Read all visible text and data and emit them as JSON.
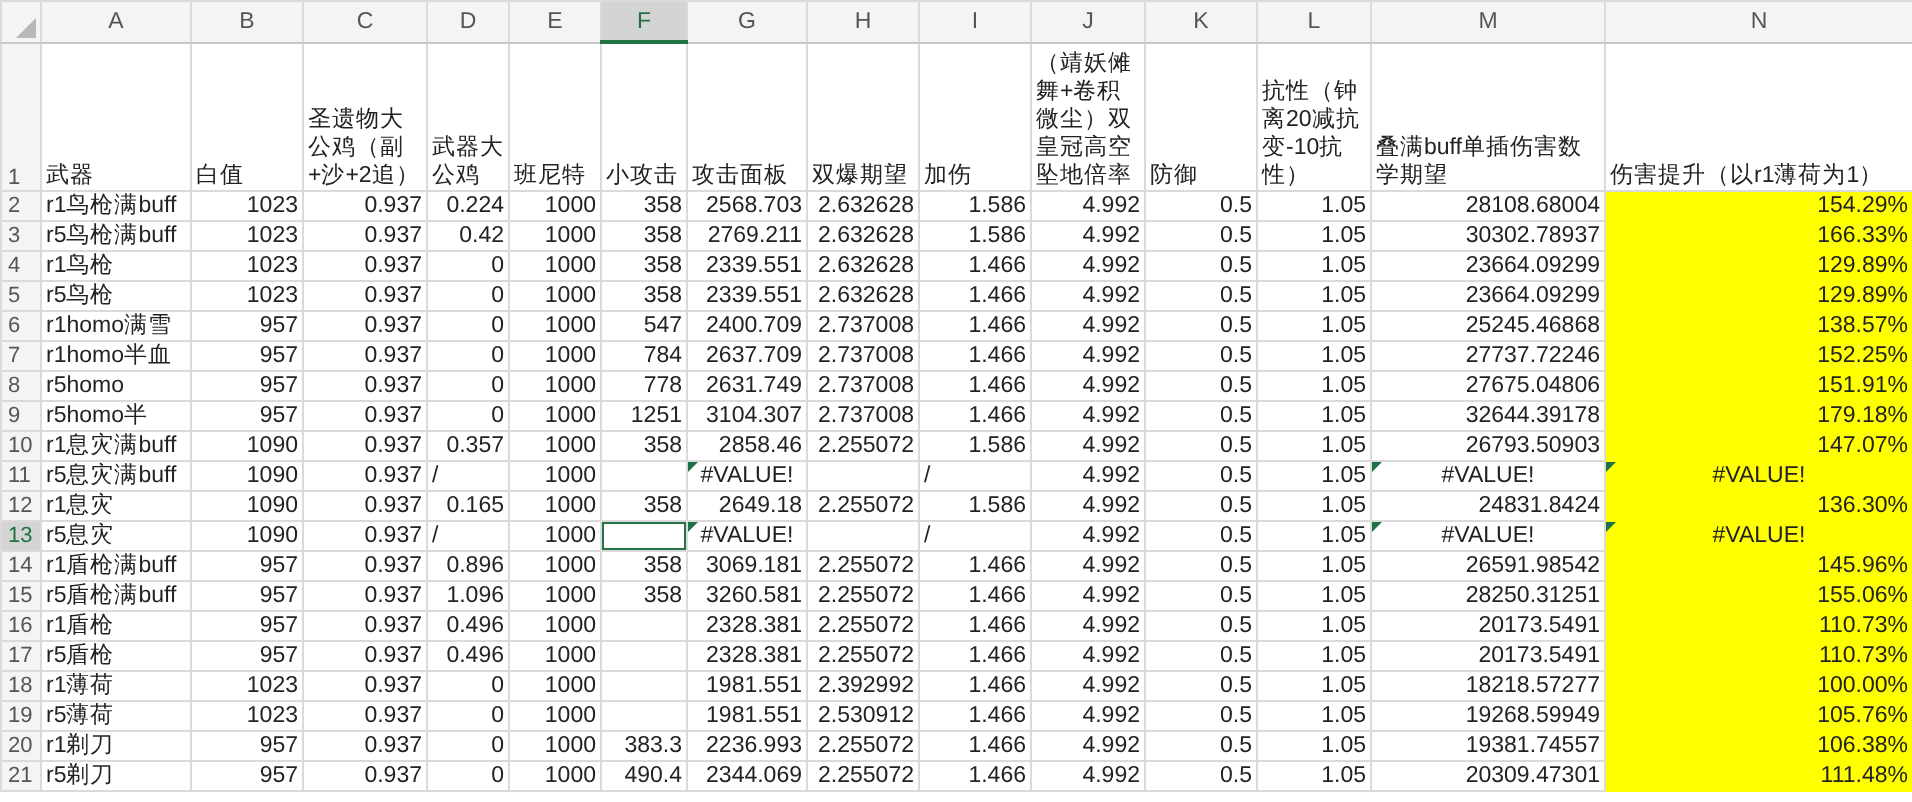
{
  "columns": [
    {
      "letter": "A",
      "selected": false,
      "highlighted": false
    },
    {
      "letter": "B",
      "selected": false,
      "highlighted": false
    },
    {
      "letter": "C",
      "selected": false,
      "highlighted": false
    },
    {
      "letter": "D",
      "selected": false,
      "highlighted": false
    },
    {
      "letter": "E",
      "selected": false,
      "highlighted": false
    },
    {
      "letter": "F",
      "selected": true,
      "highlighted": false
    },
    {
      "letter": "G",
      "selected": false,
      "highlighted": false
    },
    {
      "letter": "H",
      "selected": false,
      "highlighted": false
    },
    {
      "letter": "I",
      "selected": false,
      "highlighted": false
    },
    {
      "letter": "J",
      "selected": false,
      "highlighted": false
    },
    {
      "letter": "K",
      "selected": false,
      "highlighted": false
    },
    {
      "letter": "L",
      "selected": false,
      "highlighted": false
    },
    {
      "letter": "M",
      "selected": false,
      "highlighted": false
    },
    {
      "letter": "N",
      "selected": false,
      "highlighted": true
    }
  ],
  "header_row": {
    "number": "1",
    "cells": [
      "武器",
      "白值",
      "圣遗物大公鸡（副+沙+2追）",
      "武器大公鸡",
      "班尼特",
      "小攻击",
      "攻击面板",
      "双爆期望",
      "加伤",
      "（靖妖傩舞+卷积微尘）双皇冠高空坠地倍率",
      "防御",
      "抗性（钟离20减抗变-10抗性）",
      "叠满buff单插伤害数学期望",
      "伤害提升（以r1薄荷为1）"
    ]
  },
  "rows": [
    {
      "number": "2",
      "selected": false,
      "cells": [
        "r1鸟枪满buff",
        "1023",
        "0.937",
        "0.224",
        "1000",
        "358",
        "2568.703",
        "2.632628",
        "1.586",
        "4.992",
        "0.5",
        "1.05",
        "28108.68004",
        "154.29%"
      ],
      "error_marks": [
        false,
        false,
        false,
        false,
        false,
        false,
        false,
        false,
        false,
        false,
        false,
        false,
        false,
        false
      ]
    },
    {
      "number": "3",
      "selected": false,
      "cells": [
        "r5鸟枪满buff",
        "1023",
        "0.937",
        "0.42",
        "1000",
        "358",
        "2769.211",
        "2.632628",
        "1.586",
        "4.992",
        "0.5",
        "1.05",
        "30302.78937",
        "166.33%"
      ],
      "error_marks": [
        false,
        false,
        false,
        false,
        false,
        false,
        false,
        false,
        false,
        false,
        false,
        false,
        false,
        false
      ]
    },
    {
      "number": "4",
      "selected": false,
      "cells": [
        "r1鸟枪",
        "1023",
        "0.937",
        "0",
        "1000",
        "358",
        "2339.551",
        "2.632628",
        "1.466",
        "4.992",
        "0.5",
        "1.05",
        "23664.09299",
        "129.89%"
      ],
      "error_marks": [
        false,
        false,
        false,
        false,
        false,
        false,
        false,
        false,
        false,
        false,
        false,
        false,
        false,
        false
      ]
    },
    {
      "number": "5",
      "selected": false,
      "cells": [
        "r5鸟枪",
        "1023",
        "0.937",
        "0",
        "1000",
        "358",
        "2339.551",
        "2.632628",
        "1.466",
        "4.992",
        "0.5",
        "1.05",
        "23664.09299",
        "129.89%"
      ],
      "error_marks": [
        false,
        false,
        false,
        false,
        false,
        false,
        false,
        false,
        false,
        false,
        false,
        false,
        false,
        false
      ]
    },
    {
      "number": "6",
      "selected": false,
      "cells": [
        "r1homo满雪",
        "957",
        "0.937",
        "0",
        "1000",
        "547",
        "2400.709",
        "2.737008",
        "1.466",
        "4.992",
        "0.5",
        "1.05",
        "25245.46868",
        "138.57%"
      ],
      "error_marks": [
        false,
        false,
        false,
        false,
        false,
        false,
        false,
        false,
        false,
        false,
        false,
        false,
        false,
        false
      ]
    },
    {
      "number": "7",
      "selected": false,
      "cells": [
        "r1homo半血",
        "957",
        "0.937",
        "0",
        "1000",
        "784",
        "2637.709",
        "2.737008",
        "1.466",
        "4.992",
        "0.5",
        "1.05",
        "27737.72246",
        "152.25%"
      ],
      "error_marks": [
        false,
        false,
        false,
        false,
        false,
        false,
        false,
        false,
        false,
        false,
        false,
        false,
        false,
        false
      ]
    },
    {
      "number": "8",
      "selected": false,
      "cells": [
        "r5homo",
        "957",
        "0.937",
        "0",
        "1000",
        "778",
        "2631.749",
        "2.737008",
        "1.466",
        "4.992",
        "0.5",
        "1.05",
        "27675.04806",
        "151.91%"
      ],
      "error_marks": [
        false,
        false,
        false,
        false,
        false,
        false,
        false,
        false,
        false,
        false,
        false,
        false,
        false,
        false
      ]
    },
    {
      "number": "9",
      "selected": false,
      "cells": [
        "r5homo半",
        "957",
        "0.937",
        "0",
        "1000",
        "1251",
        "3104.307",
        "2.737008",
        "1.466",
        "4.992",
        "0.5",
        "1.05",
        "32644.39178",
        "179.18%"
      ],
      "error_marks": [
        false,
        false,
        false,
        false,
        false,
        false,
        false,
        false,
        false,
        false,
        false,
        false,
        false,
        false
      ]
    },
    {
      "number": "10",
      "selected": false,
      "cells": [
        "r1息灾满buff",
        "1090",
        "0.937",
        "0.357",
        "1000",
        "358",
        "2858.46",
        "2.255072",
        "1.586",
        "4.992",
        "0.5",
        "1.05",
        "26793.50903",
        "147.07%"
      ],
      "error_marks": [
        false,
        false,
        false,
        false,
        false,
        false,
        false,
        false,
        false,
        false,
        false,
        false,
        false,
        false
      ]
    },
    {
      "number": "11",
      "selected": false,
      "cells": [
        "r5息灾满buff",
        "1090",
        "0.937",
        "/",
        "1000",
        null,
        "#VALUE!",
        null,
        "/",
        "4.992",
        "0.5",
        "1.05",
        "#VALUE!",
        "#VALUE!"
      ],
      "error_marks": [
        false,
        false,
        false,
        false,
        false,
        false,
        true,
        false,
        false,
        false,
        false,
        false,
        true,
        true
      ]
    },
    {
      "number": "12",
      "selected": false,
      "cells": [
        "r1息灾",
        "1090",
        "0.937",
        "0.165",
        "1000",
        "358",
        "2649.18",
        "2.255072",
        "1.586",
        "4.992",
        "0.5",
        "1.05",
        "24831.8424",
        "136.30%"
      ],
      "error_marks": [
        false,
        false,
        false,
        false,
        false,
        false,
        false,
        false,
        false,
        false,
        false,
        false,
        false,
        false
      ]
    },
    {
      "number": "13",
      "selected": true,
      "cells": [
        "r5息灾",
        "1090",
        "0.937",
        "/",
        "1000",
        null,
        "#VALUE!",
        null,
        "/",
        "4.992",
        "0.5",
        "1.05",
        "#VALUE!",
        "#VALUE!"
      ],
      "error_marks": [
        false,
        false,
        false,
        false,
        false,
        false,
        true,
        false,
        false,
        false,
        false,
        false,
        true,
        true
      ]
    },
    {
      "number": "14",
      "selected": false,
      "cells": [
        "r1盾枪满buff",
        "957",
        "0.937",
        "0.896",
        "1000",
        "358",
        "3069.181",
        "2.255072",
        "1.466",
        "4.992",
        "0.5",
        "1.05",
        "26591.98542",
        "145.96%"
      ],
      "error_marks": [
        false,
        false,
        false,
        false,
        false,
        false,
        false,
        false,
        false,
        false,
        false,
        false,
        false,
        false
      ]
    },
    {
      "number": "15",
      "selected": false,
      "cells": [
        "r5盾枪满buff",
        "957",
        "0.937",
        "1.096",
        "1000",
        "358",
        "3260.581",
        "2.255072",
        "1.466",
        "4.992",
        "0.5",
        "1.05",
        "28250.31251",
        "155.06%"
      ],
      "error_marks": [
        false,
        false,
        false,
        false,
        false,
        false,
        false,
        false,
        false,
        false,
        false,
        false,
        false,
        false
      ]
    },
    {
      "number": "16",
      "selected": false,
      "cells": [
        "r1盾枪",
        "957",
        "0.937",
        "0.496",
        "1000",
        null,
        "2328.381",
        "2.255072",
        "1.466",
        "4.992",
        "0.5",
        "1.05",
        "20173.5491",
        "110.73%"
      ],
      "error_marks": [
        false,
        false,
        false,
        false,
        false,
        false,
        false,
        false,
        false,
        false,
        false,
        false,
        false,
        false
      ]
    },
    {
      "number": "17",
      "selected": false,
      "cells": [
        "r5盾枪",
        "957",
        "0.937",
        "0.496",
        "1000",
        null,
        "2328.381",
        "2.255072",
        "1.466",
        "4.992",
        "0.5",
        "1.05",
        "20173.5491",
        "110.73%"
      ],
      "error_marks": [
        false,
        false,
        false,
        false,
        false,
        false,
        false,
        false,
        false,
        false,
        false,
        false,
        false,
        false
      ]
    },
    {
      "number": "18",
      "selected": false,
      "cells": [
        "r1薄荷",
        "1023",
        "0.937",
        "0",
        "1000",
        null,
        "1981.551",
        "2.392992",
        "1.466",
        "4.992",
        "0.5",
        "1.05",
        "18218.57277",
        "100.00%"
      ],
      "error_marks": [
        false,
        false,
        false,
        false,
        false,
        false,
        false,
        false,
        false,
        false,
        false,
        false,
        false,
        false
      ]
    },
    {
      "number": "19",
      "selected": false,
      "cells": [
        "r5薄荷",
        "1023",
        "0.937",
        "0",
        "1000",
        null,
        "1981.551",
        "2.530912",
        "1.466",
        "4.992",
        "0.5",
        "1.05",
        "19268.59949",
        "105.76%"
      ],
      "error_marks": [
        false,
        false,
        false,
        false,
        false,
        false,
        false,
        false,
        false,
        false,
        false,
        false,
        false,
        false
      ]
    },
    {
      "number": "20",
      "selected": false,
      "cells": [
        "r1剃刀",
        "957",
        "0.937",
        "0",
        "1000",
        "383.3",
        "2236.993",
        "2.255072",
        "1.466",
        "4.992",
        "0.5",
        "1.05",
        "19381.74557",
        "106.38%"
      ],
      "error_marks": [
        false,
        false,
        false,
        false,
        false,
        false,
        false,
        false,
        false,
        false,
        false,
        false,
        false,
        false
      ]
    },
    {
      "number": "21",
      "selected": false,
      "cells": [
        "r5剃刀",
        "957",
        "0.937",
        "0",
        "1000",
        "490.4",
        "2344.069",
        "2.255072",
        "1.466",
        "4.992",
        "0.5",
        "1.05",
        "20309.47301",
        "111.48%"
      ],
      "error_marks": [
        false,
        false,
        false,
        false,
        false,
        false,
        false,
        false,
        false,
        false,
        false,
        false,
        false,
        false
      ]
    }
  ]
}
